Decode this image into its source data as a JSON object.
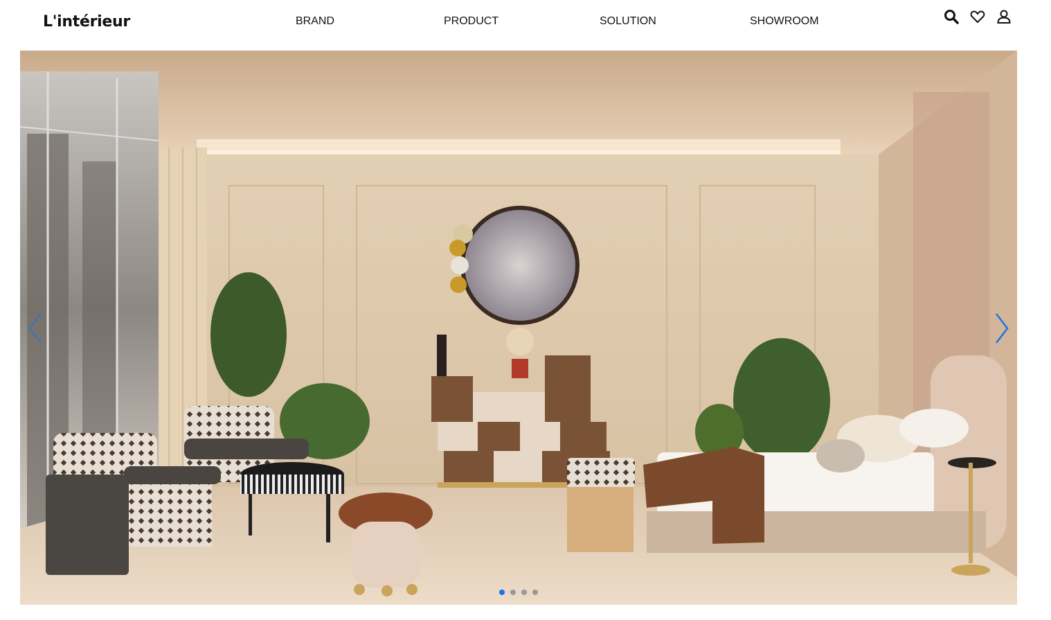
{
  "brand": {
    "logo_text": "L'intérieur"
  },
  "nav": {
    "items": [
      {
        "label": "BRAND"
      },
      {
        "label": "PRODUCT"
      },
      {
        "label": "SOLUTION"
      },
      {
        "label": "SHOWROOM"
      }
    ]
  },
  "header_icons": [
    "search-icon",
    "heart-icon",
    "user-icon"
  ],
  "carousel": {
    "slide_count": 4,
    "active_index": 0,
    "slide_image": "luxury-bedroom-interior",
    "colors": {
      "dot_active": "#1a73e8",
      "dot_inactive": "#999999",
      "arrow": "#1a73e8"
    }
  }
}
